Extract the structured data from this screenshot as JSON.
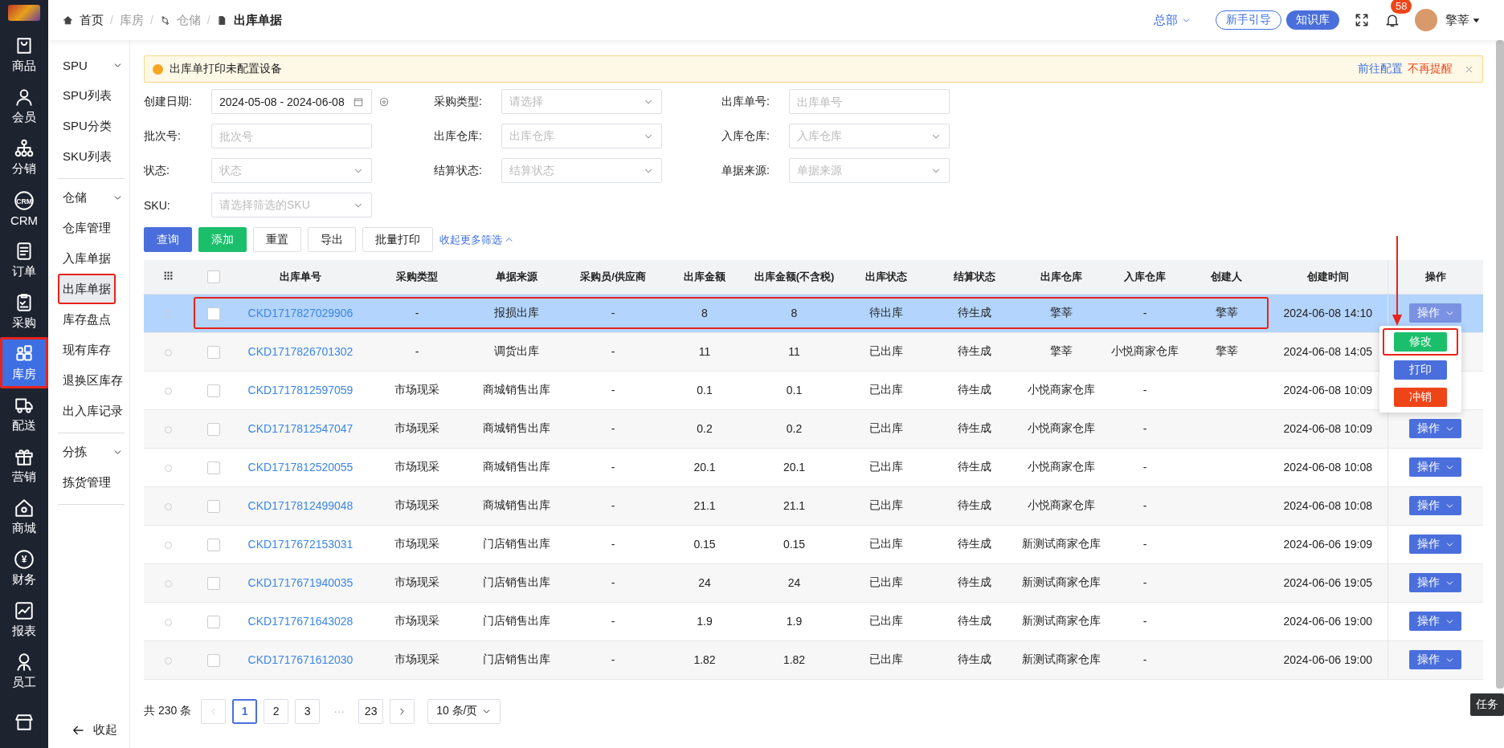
{
  "rail": {
    "items": [
      {
        "label": "商品",
        "selected": false,
        "highlighted": false
      },
      {
        "label": "会员",
        "selected": false,
        "highlighted": false
      },
      {
        "label": "分销",
        "selected": false,
        "highlighted": false
      },
      {
        "label": "CRM",
        "icon_text": "CRM",
        "selected": false,
        "highlighted": false
      },
      {
        "label": "订单",
        "selected": false,
        "highlighted": false
      },
      {
        "label": "采购",
        "selected": false,
        "highlighted": false
      },
      {
        "label": "库房",
        "selected": true,
        "highlighted": true
      },
      {
        "label": "配送",
        "selected": false,
        "highlighted": false
      },
      {
        "label": "营销",
        "selected": false,
        "highlighted": false
      },
      {
        "label": "商城",
        "selected": false,
        "highlighted": false
      },
      {
        "label": "财务",
        "icon_text": "¥",
        "selected": false,
        "highlighted": false
      },
      {
        "label": "报表",
        "selected": false,
        "highlighted": false
      },
      {
        "label": "员工",
        "selected": false,
        "highlighted": false
      },
      {
        "selected": false,
        "highlighted": false
      }
    ]
  },
  "breadcrumb": [
    {
      "label": "首页",
      "kind": "home",
      "current": false
    },
    {
      "separator": "/",
      "label": "库房",
      "kind": "plain",
      "current": false
    },
    {
      "separator": "/",
      "label": "仓储",
      "kind": "branch",
      "current": false
    },
    {
      "separator": "/",
      "label": "出库单据",
      "kind": "doc",
      "current": true
    }
  ],
  "header": {
    "org": "总部",
    "guide": "新手引导",
    "knowledge": "知识库",
    "badge": "58",
    "user": "擎莘"
  },
  "sidebar": {
    "groups": [
      {
        "title": "SPU",
        "expanded": true,
        "items": [
          {
            "label": "SPU列表",
            "selected": false,
            "highlighted": false
          },
          {
            "label": "SPU分类",
            "selected": false,
            "highlighted": false
          },
          {
            "label": "SKU列表",
            "selected": false,
            "highlighted": false
          }
        ]
      },
      {
        "title": "仓储",
        "expanded": true,
        "items": [
          {
            "label": "仓库管理",
            "selected": false,
            "highlighted": false
          },
          {
            "label": "入库单据",
            "selected": false,
            "highlighted": false
          },
          {
            "label": "出库单据",
            "selected": true,
            "highlighted": true
          },
          {
            "label": "库存盘点",
            "selected": false,
            "highlighted": false
          },
          {
            "label": "现有库存",
            "selected": false,
            "highlighted": false
          },
          {
            "label": "退换区库存",
            "selected": false,
            "highlighted": false
          },
          {
            "label": "出入库记录",
            "selected": false,
            "highlighted": false
          }
        ]
      },
      {
        "title": "分拣",
        "expanded": true,
        "items": [
          {
            "label": "拣货管理",
            "selected": false,
            "highlighted": false
          }
        ]
      }
    ],
    "collapse": "收起"
  },
  "alert": {
    "message": "出库单打印未配置设备",
    "link": "前往配置",
    "dismiss": "不再提醒"
  },
  "filters": [
    {
      "label": "创建日期:",
      "kind": "date_range",
      "value": "2024-05-08 - 2024-06-08"
    },
    {
      "label": "采购类型:",
      "kind": "select",
      "placeholder": "请选择"
    },
    {
      "label": "出库单号:",
      "kind": "text",
      "placeholder": "出库单号"
    },
    {
      "label": "批次号:",
      "kind": "text",
      "placeholder": "批次号"
    },
    {
      "label": "出库仓库:",
      "kind": "select",
      "placeholder": "出库仓库"
    },
    {
      "label": "入库仓库:",
      "kind": "select",
      "placeholder": "入库仓库"
    },
    {
      "label": "状态:",
      "kind": "select",
      "placeholder": "状态"
    },
    {
      "label": "结算状态:",
      "kind": "select",
      "placeholder": "结算状态"
    },
    {
      "label": "单据来源:",
      "kind": "select",
      "placeholder": "单据来源"
    },
    {
      "label": "SKU:",
      "kind": "select",
      "placeholder": "请选择筛选的SKU"
    }
  ],
  "actions": [
    {
      "label": "查询",
      "kind": "primary"
    },
    {
      "label": "添加",
      "kind": "success"
    },
    {
      "label": "重置",
      "kind": "default"
    },
    {
      "label": "导出",
      "kind": "default"
    },
    {
      "label": "批量打印",
      "kind": "default"
    }
  ],
  "toggle_filters": "收起更多筛选",
  "table": {
    "all_checked": false,
    "columns": [
      "出库单号",
      "采购类型",
      "单据来源",
      "采购员/供应商",
      "出库金额",
      "出库金额(不含税)",
      "出库状态",
      "结算状态",
      "出库仓库",
      "入库仓库",
      "创建人",
      "创建时间",
      "操作"
    ],
    "rows": [
      {
        "cells": [
          "CKD1717827029906",
          "-",
          "报损出库",
          "-",
          "8",
          "8",
          "待出库",
          "待生成",
          "擎莘",
          "-",
          "擎莘",
          "2024-06-08 14:10"
        ],
        "action": "操作",
        "checked": false,
        "radio_selected": false,
        "selected": true,
        "highlighted": true,
        "menu_open": true
      },
      {
        "cells": [
          "CKD1717826701302",
          "-",
          "调货出库",
          "-",
          "11",
          "11",
          "已出库",
          "待生成",
          "擎莘",
          "小悦商家仓库",
          "擎莘",
          "2024-06-08 14:05"
        ],
        "checked": false,
        "radio_selected": false,
        "selected": false,
        "highlighted": false,
        "menu_open": false
      },
      {
        "cells": [
          "CKD1717812597059",
          "市场现采",
          "商城销售出库",
          "-",
          "0.1",
          "0.1",
          "已出库",
          "待生成",
          "小悦商家仓库",
          "-",
          null,
          "2024-06-08 10:09"
        ],
        "checked": false,
        "radio_selected": false,
        "selected": false,
        "highlighted": false,
        "menu_open": false
      },
      {
        "cells": [
          "CKD1717812547047",
          "市场现采",
          "商城销售出库",
          "-",
          "0.2",
          "0.2",
          "已出库",
          "待生成",
          "小悦商家仓库",
          "-",
          null,
          "2024-06-08 10:09"
        ],
        "action": "操作",
        "checked": false,
        "radio_selected": false,
        "selected": false,
        "highlighted": false,
        "menu_open": false
      },
      {
        "cells": [
          "CKD1717812520055",
          "市场现采",
          "商城销售出库",
          "-",
          "20.1",
          "20.1",
          "已出库",
          "待生成",
          "小悦商家仓库",
          "-",
          null,
          "2024-06-08 10:08"
        ],
        "action": "操作",
        "checked": false,
        "radio_selected": false,
        "selected": false,
        "highlighted": false,
        "menu_open": false
      },
      {
        "cells": [
          "CKD1717812499048",
          "市场现采",
          "商城销售出库",
          "-",
          "21.1",
          "21.1",
          "已出库",
          "待生成",
          "小悦商家仓库",
          "-",
          null,
          "2024-06-08 10:08"
        ],
        "action": "操作",
        "checked": false,
        "radio_selected": false,
        "selected": false,
        "highlighted": false,
        "menu_open": false
      },
      {
        "cells": [
          "CKD1717672153031",
          "市场现采",
          "门店销售出库",
          "-",
          "0.15",
          "0.15",
          "已出库",
          "待生成",
          "新测试商家仓库",
          "-",
          null,
          "2024-06-06 19:09"
        ],
        "action": "操作",
        "checked": false,
        "radio_selected": false,
        "selected": false,
        "highlighted": false,
        "menu_open": false
      },
      {
        "cells": [
          "CKD1717671940035",
          "市场现采",
          "门店销售出库",
          "-",
          "24",
          "24",
          "已出库",
          "待生成",
          "新测试商家仓库",
          "-",
          null,
          "2024-06-06 19:05"
        ],
        "action": "操作",
        "checked": false,
        "radio_selected": false,
        "selected": false,
        "highlighted": false,
        "menu_open": false
      },
      {
        "cells": [
          "CKD1717671643028",
          "市场现采",
          "门店销售出库",
          "-",
          "1.9",
          "1.9",
          "已出库",
          "待生成",
          "新测试商家仓库",
          "-",
          null,
          "2024-06-06 19:00"
        ],
        "action": "操作",
        "checked": false,
        "radio_selected": false,
        "selected": false,
        "highlighted": false,
        "menu_open": false
      },
      {
        "cells": [
          "CKD1717671612030",
          "市场现采",
          "门店销售出库",
          "-",
          "1.82",
          "1.82",
          "已出库",
          "待生成",
          "新测试商家仓库",
          "-",
          null,
          "2024-06-06 19:00"
        ],
        "action": "操作",
        "checked": false,
        "radio_selected": false,
        "selected": false,
        "highlighted": false,
        "menu_open": false
      }
    ]
  },
  "action_menu": {
    "pointer_arrow": true,
    "items": [
      {
        "label": "修改",
        "color": "#1bbf6b",
        "highlighted": true
      },
      {
        "label": "打印",
        "color": "#4a6fdc",
        "highlighted": false
      },
      {
        "label": "冲销",
        "color": "#ee4518",
        "highlighted": false
      }
    ]
  },
  "pagination": {
    "total": "共 230 条",
    "prev_disabled": true,
    "next_disabled": false,
    "pages": [
      {
        "label": "1",
        "kind": "page",
        "selected": true
      },
      {
        "label": "2",
        "kind": "page",
        "selected": false
      },
      {
        "label": "3",
        "kind": "page",
        "selected": false
      },
      {
        "label": "···",
        "kind": "ellipsis"
      },
      {
        "label": "23",
        "kind": "page",
        "selected": false
      }
    ],
    "page_size": "10 条/页"
  },
  "tooltip": "任务"
}
